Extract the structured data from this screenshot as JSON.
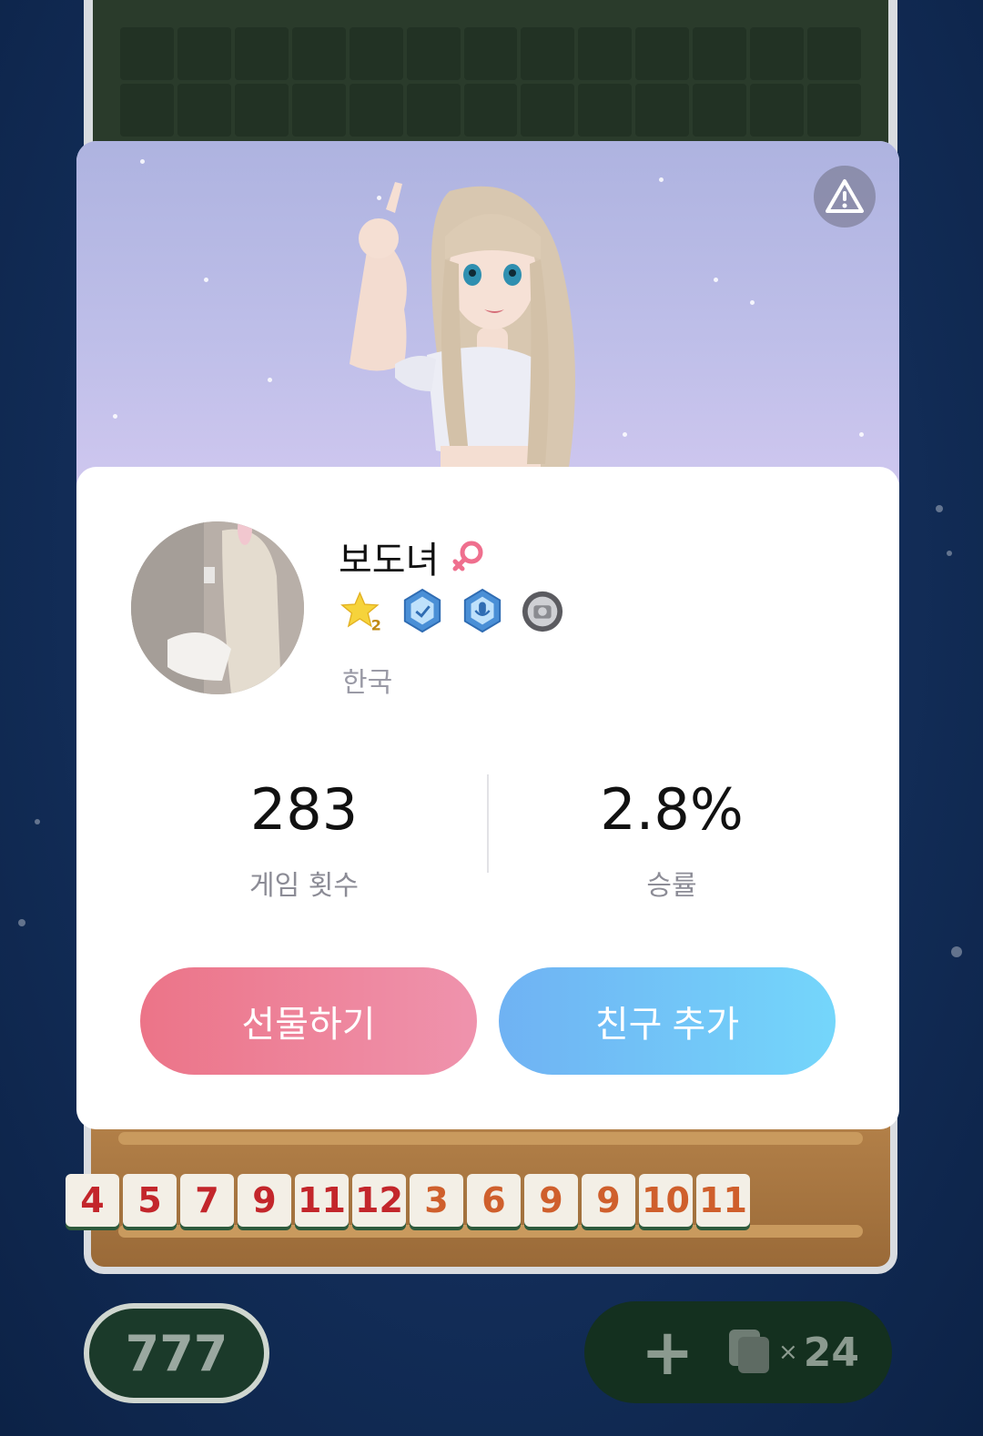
{
  "game": {
    "rack_tiles": [
      {
        "value": "4",
        "color": "#c3262b"
      },
      {
        "value": "5",
        "color": "#c3262b"
      },
      {
        "value": "7",
        "color": "#c3262b"
      },
      {
        "value": "9",
        "color": "#c3262b"
      },
      {
        "value": "11",
        "color": "#c3262b"
      },
      {
        "value": "12",
        "color": "#c3262b"
      },
      {
        "value": "3",
        "color": "#cf5f2c"
      },
      {
        "value": "6",
        "color": "#cf5f2c"
      },
      {
        "value": "9",
        "color": "#cf5f2c"
      },
      {
        "value": "9",
        "color": "#cf5f2c"
      },
      {
        "value": "10",
        "color": "#cf5f2c"
      },
      {
        "value": "11",
        "color": "#cf5f2c"
      }
    ],
    "score_pill": "777",
    "draw_plus": "+",
    "draw_times": "×",
    "draw_count": "24"
  },
  "profile": {
    "username": "보도녀",
    "gender_icon": "female-icon",
    "badges": [
      "star-level-2-badge",
      "blue-shield-badge",
      "microphone-badge",
      "gray-camera-badge"
    ],
    "badge_level_text": "2",
    "region": "한국",
    "stats": {
      "games_value": "283",
      "games_label": "게임 횟수",
      "winrate_value": "2.8%",
      "winrate_label": "승률"
    },
    "gift_button": "선물하기",
    "add_friend_button": "친구 추가"
  },
  "colors": {
    "gift_button": "#ec7488",
    "friend_button": "#6fb2f3",
    "female_icon": "#ef6f8e"
  }
}
